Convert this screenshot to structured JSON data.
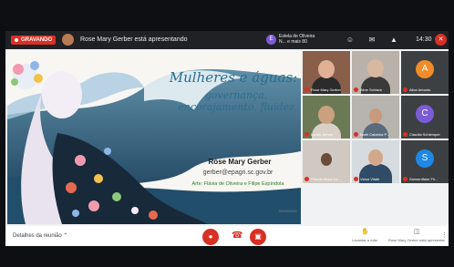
{
  "topbar": {
    "recording_label": "GRAVANDO",
    "presenter_text": "Rose Mary Gerber está apresentando",
    "others_initial": "E",
    "others_text": "Estela de Oliveira N... e mais 80",
    "clock": "14:30"
  },
  "slide": {
    "title": "Mulheres e águas:",
    "subtitle_line1": "governança,",
    "subtitle_line2": "encorajamento, fluidez",
    "presenter_name": "Rose Mary Gerber",
    "email": "gerber@epagri.sc.gov.br",
    "credit": "Arte: Flávia de Oliveira e Filipe Espíndola",
    "footnote": "02/02/2021"
  },
  "participants": [
    {
      "name": "Rose Mary Gerber",
      "type": "video"
    },
    {
      "name": "Aline Schlack",
      "type": "video"
    },
    {
      "name": "Alice Arbusto",
      "type": "letter",
      "initial": "A",
      "color": "#f28c28"
    },
    {
      "name": "Lenita Jemes",
      "type": "video"
    },
    {
      "name": "Noeli Catarina P...",
      "type": "video"
    },
    {
      "name": "Claudia Schlemper",
      "type": "letter",
      "initial": "C",
      "color": "#7b5cd6"
    },
    {
      "name": "Priscila Mara Do...",
      "type": "video"
    },
    {
      "name": "Victor Vitale",
      "type": "video"
    },
    {
      "name": "Salmenffaire Fil...",
      "type": "letter",
      "initial": "S",
      "color": "#1e88e5"
    }
  ],
  "bottombar": {
    "meeting_details": "Detalhes da reunião",
    "raise_hand": "Levantar a mão",
    "presenting": "Rose Mary Gerber está apresentando"
  },
  "colors": {
    "recording": "#d93025",
    "title_blue": "#2c6e8e",
    "credit_green": "#2b7a2b"
  }
}
